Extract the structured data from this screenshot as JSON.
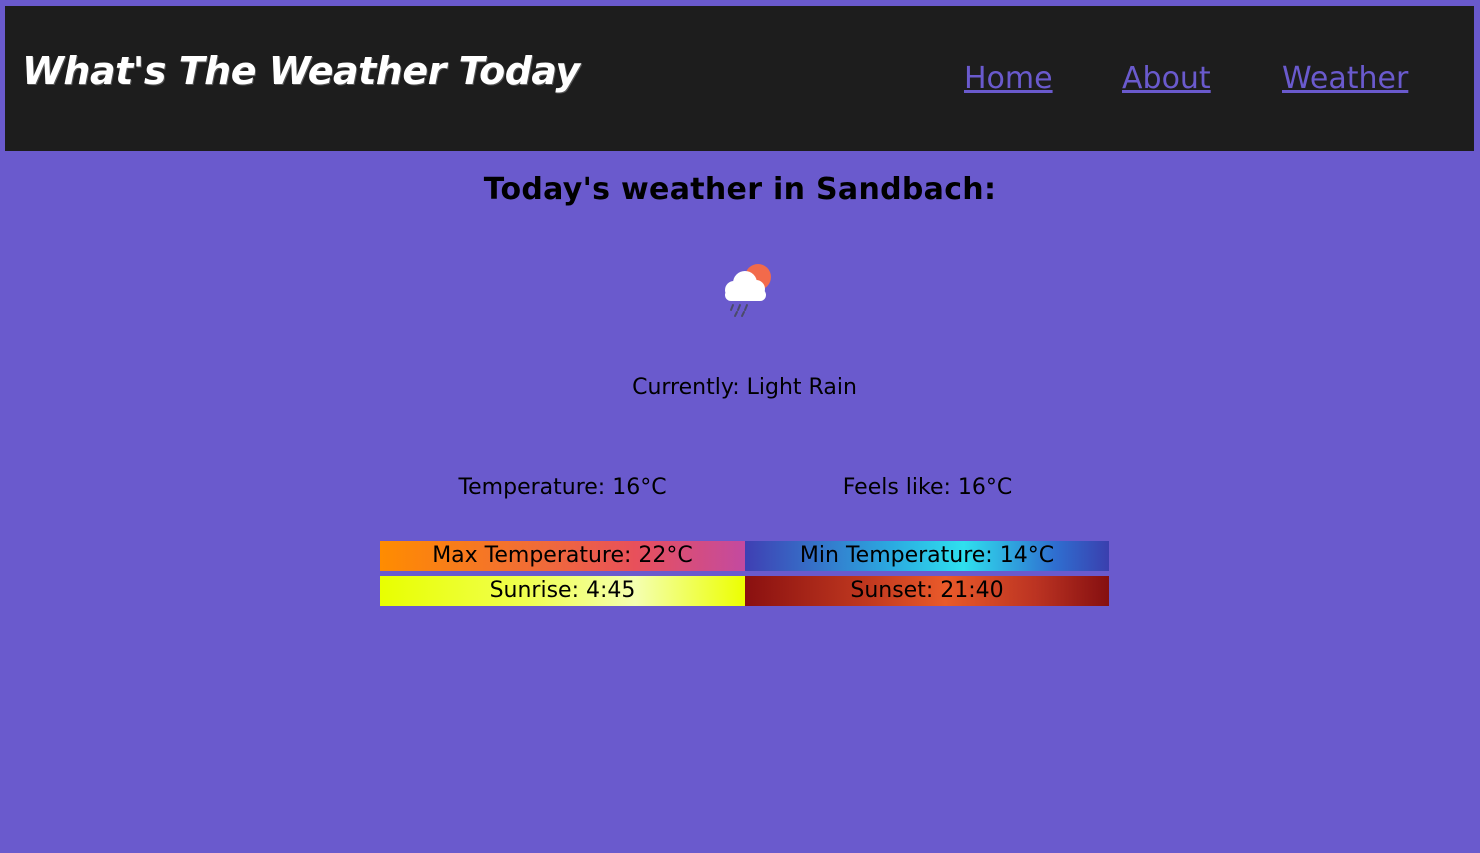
{
  "header": {
    "brand": "What's The Weather Today",
    "nav": [
      {
        "label": "Home"
      },
      {
        "label": "About"
      },
      {
        "label": "Weather"
      }
    ]
  },
  "main": {
    "title": "Today's weather in Sandbach:",
    "icon": "cloud-rain-sun-icon",
    "current": "Currently: Light Rain",
    "temperature": "Temperature: 16°C",
    "feels_like": "Feels like: 16°C",
    "max_temp": "Max Temperature: 22°C",
    "min_temp": "Min Temperature: 14°C",
    "sunrise": "Sunrise: 4:45",
    "sunset": "Sunset: 21:40"
  },
  "colors": {
    "background": "#6a5acd",
    "header": "#1d1d1d",
    "nav_link": "#6a5acd",
    "brand_text": "#ffffff"
  }
}
